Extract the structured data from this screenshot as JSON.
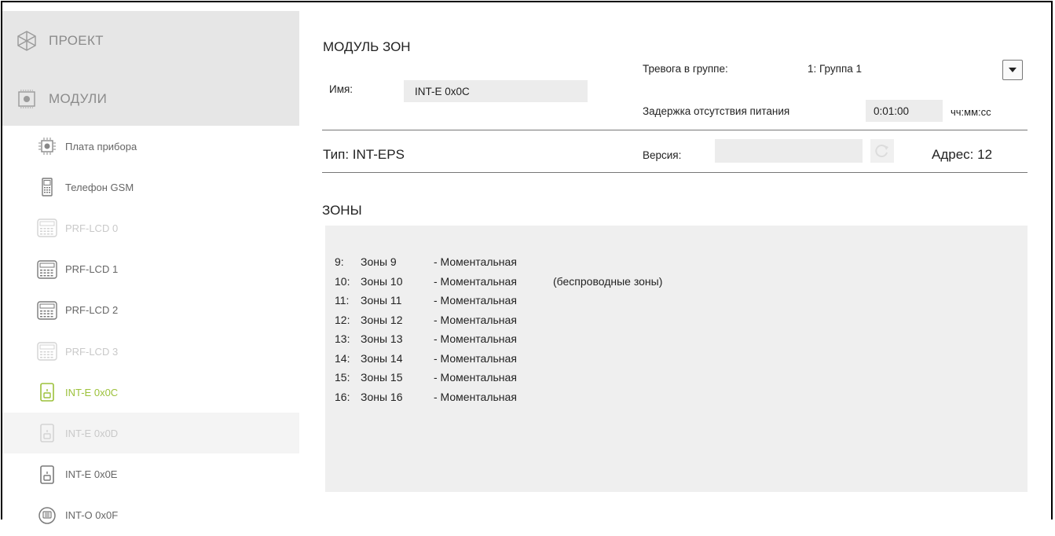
{
  "sidebar": {
    "project_label": "ПРОЕКТ",
    "modules_label": "МОДУЛИ",
    "items": [
      {
        "label": "Плата прибора",
        "icon": "board-chip-icon",
        "state": "normal"
      },
      {
        "label": "Телефон GSM",
        "icon": "gsm-phone-icon",
        "state": "normal"
      },
      {
        "label": "PRF-LCD 0",
        "icon": "keypad-lcd-icon",
        "state": "disabled"
      },
      {
        "label": "PRF-LCD 1",
        "icon": "keypad-lcd-icon",
        "state": "normal"
      },
      {
        "label": "PRF-LCD 2",
        "icon": "keypad-lcd-icon",
        "state": "normal"
      },
      {
        "label": "PRF-LCD 3",
        "icon": "keypad-lcd-icon",
        "state": "disabled"
      },
      {
        "label": "INT-E 0x0C",
        "icon": "expander-module-icon",
        "state": "active"
      },
      {
        "label": "INT-E 0x0D",
        "icon": "expander-module-icon",
        "state": "disabled"
      },
      {
        "label": "INT-E 0x0E",
        "icon": "expander-module-icon",
        "state": "normal"
      },
      {
        "label": "INT-O 0x0F",
        "icon": "output-module-icon",
        "state": "normal"
      }
    ]
  },
  "module": {
    "title": "МОДУЛЬ ЗОН",
    "name_label": "Имя:",
    "name_value": "INT-E 0x0C",
    "alarm_group_label": "Тревога в группе:",
    "alarm_group_value": "1: Группа 1",
    "power_delay_label": "Задержка отсутствия питания",
    "power_delay_value": "0:01:00",
    "power_delay_unit": "чч:мм:сс",
    "type_label": "Тип:",
    "type_value": "INT-EPS",
    "version_label": "Версия:",
    "version_value": "",
    "address_label": "Адрес:",
    "address_value": "12"
  },
  "zones": {
    "title": "ЗОНЫ",
    "rows": [
      {
        "num": "9:",
        "name": "Зоны 9",
        "type": "- Моментальная",
        "note": ""
      },
      {
        "num": "10:",
        "name": "Зоны 10",
        "type": "- Моментальная",
        "note": "(беспроводные зоны)"
      },
      {
        "num": "11:",
        "name": "Зоны 11",
        "type": "- Моментальная",
        "note": ""
      },
      {
        "num": "12:",
        "name": "Зоны 12",
        "type": "- Моментальная",
        "note": ""
      },
      {
        "num": "13:",
        "name": "Зоны 13",
        "type": "- Моментальная",
        "note": ""
      },
      {
        "num": "14:",
        "name": "Зоны 14",
        "type": "- Моментальная",
        "note": ""
      },
      {
        "num": "15:",
        "name": "Зоны 15",
        "type": "- Моментальная",
        "note": ""
      },
      {
        "num": "16:",
        "name": "Зоны 16",
        "type": "- Моментальная",
        "note": ""
      }
    ]
  },
  "colors": {
    "active": "#9cc13a",
    "sidebar_head_bg": "#e6e6e6",
    "zones_bg": "#efefef"
  }
}
